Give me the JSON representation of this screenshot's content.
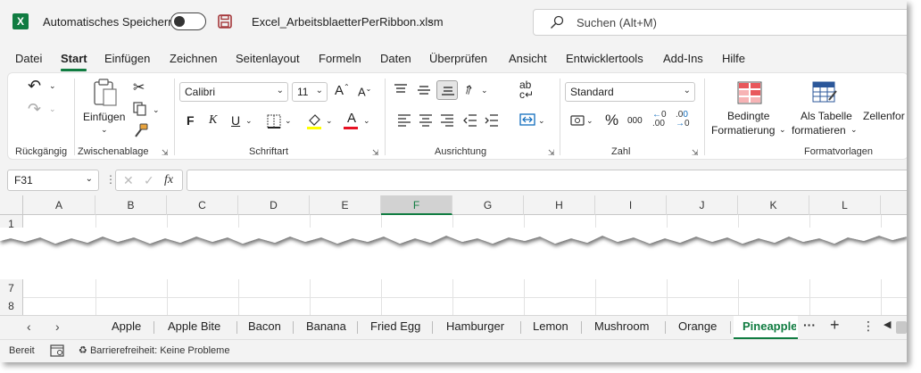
{
  "titlebar": {
    "app_logo": "X",
    "autosave_label": "Automatisches Speichern",
    "filename": "Excel_ArbeitsblaetterPerRibbon.xlsm",
    "search_placeholder": "Suchen (Alt+M)",
    "colors": {
      "accent": "#107c41",
      "save_icon": "#a4373a"
    }
  },
  "menu": {
    "tabs": [
      "Datei",
      "Start",
      "Einfügen",
      "Zeichnen",
      "Seitenlayout",
      "Formeln",
      "Daten",
      "Überprüfen",
      "Ansicht",
      "Entwicklertools",
      "Add-Ins",
      "Hilfe"
    ],
    "active": "Start"
  },
  "ribbon": {
    "groups": {
      "undo": "Rückgängig",
      "clipboard": "Zwischenablage",
      "font": "Schriftart",
      "alignment": "Ausrichtung",
      "number": "Zahl",
      "styles": "Formatvorlagen"
    },
    "paste_label": "Einfügen",
    "font_name": "Calibri",
    "font_size": "11",
    "bold": "F",
    "italic": "K",
    "underline": "U",
    "number_format": "Standard",
    "percent": "%",
    "thousands": "000",
    "cond_format_line1": "Bedingte",
    "cond_format_line2": "Formatierung",
    "as_table_line1": "Als Tabelle",
    "as_table_line2": "formatieren",
    "cell_styles": "Zellenfor",
    "increase_font": "A",
    "decrease_font": "A",
    "font_color_letter": "A",
    "wrap_text": "ab",
    "wrap_text_2": "c",
    "dec_inc": ".00",
    "dec_dec": ".0"
  },
  "formulabar": {
    "namebox": "F31",
    "fx": "fx",
    "dots": "⋮",
    "cancel": "✕",
    "enter": "✓"
  },
  "grid": {
    "columns": [
      "A",
      "B",
      "C",
      "D",
      "E",
      "F",
      "G",
      "H",
      "I",
      "J",
      "K",
      "L"
    ],
    "selected_column": "F",
    "rows_top": [
      "1"
    ],
    "rows_bottom": [
      "7",
      "8"
    ]
  },
  "sheets": {
    "names": [
      "Apple",
      "Apple Bite",
      "Bacon",
      "Banana",
      "Fried Egg",
      "Hamburger",
      "Lemon",
      "Mushroom",
      "Orange",
      "Pineapple"
    ],
    "active": "Pineapple",
    "nav_prev": "‹",
    "nav_next": "›",
    "more": "···",
    "add": "+",
    "options": "⋮"
  },
  "status": {
    "ready": "Bereit",
    "accessibility": "Barrierefreiheit: Keine Probleme"
  }
}
